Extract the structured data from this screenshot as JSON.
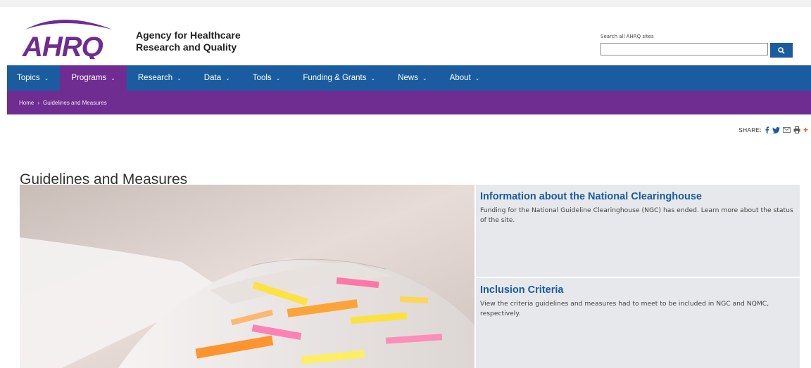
{
  "header": {
    "logo_text": "AHRQ",
    "agency_line1": "Agency for Healthcare",
    "agency_line2": "Research and Quality",
    "search_label": "Search all AHRQ sites",
    "search_value": ""
  },
  "nav": {
    "items": [
      {
        "label": "Topics"
      },
      {
        "label": "Programs"
      },
      {
        "label": "Research"
      },
      {
        "label": "Data"
      },
      {
        "label": "Tools"
      },
      {
        "label": "Funding & Grants"
      },
      {
        "label": "News"
      },
      {
        "label": "About"
      }
    ],
    "active": "Programs"
  },
  "breadcrumb": {
    "home": "Home",
    "current": "Guidelines and Measures"
  },
  "share": {
    "label": "SHARE:"
  },
  "page": {
    "title": "Guidelines and Measures"
  },
  "cards": [
    {
      "title": "Information about the National Clearinghouse",
      "body": "Funding for the National Guideline Clearinghouse (NGC) has ended. Learn more about the status of the site."
    },
    {
      "title": "Inclusion Criteria",
      "body": "View the criteria guidelines and measures had to meet to be included in NGC and NQMC, respectively."
    }
  ],
  "colors": {
    "nav": "#1a5c9f",
    "purple": "#6f2c91",
    "card_bg": "#e6e8eb",
    "link": "#1a5c9f"
  }
}
